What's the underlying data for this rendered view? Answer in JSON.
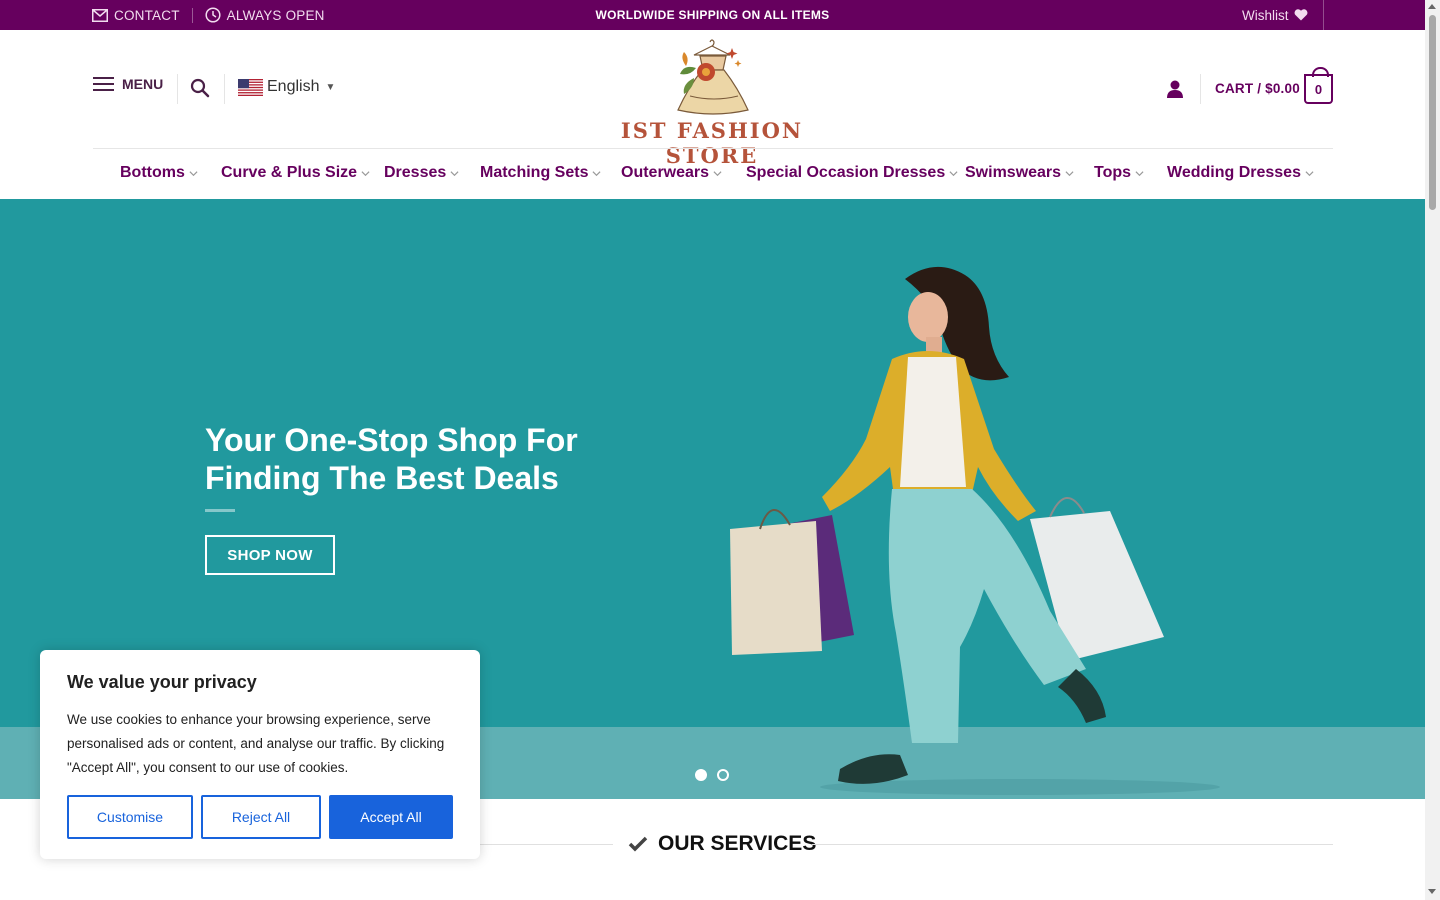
{
  "topbar": {
    "contact": "CONTACT",
    "always_open": "ALWAYS OPEN",
    "shipping": "WORLDWIDE SHIPPING ON ALL ITEMS",
    "wishlist": "Wishlist"
  },
  "header": {
    "menu_label": "MENU",
    "language": "English",
    "logo_text": "IST FASHION STORE",
    "cart_label": "CART / $0.00",
    "cart_count": "0"
  },
  "nav": {
    "items": [
      {
        "label": "Bottoms"
      },
      {
        "label": "Curve & Plus Size"
      },
      {
        "label": "Dresses"
      },
      {
        "label": "Matching Sets"
      },
      {
        "label": "Outerwears"
      },
      {
        "label": "Special Occasion Dresses"
      },
      {
        "label": "Swimswears"
      },
      {
        "label": "Tops"
      },
      {
        "label": "Wedding Dresses"
      }
    ]
  },
  "hero": {
    "title": "Your One-Stop Shop For Finding The Best Deals",
    "cta": "SHOP NOW",
    "slides": 2,
    "active_slide": 1
  },
  "services": {
    "title": "OUR SERVICES"
  },
  "cookie": {
    "title": "We value your privacy",
    "text": "We use cookies to enhance your browsing experience, serve personalised ads or content, and analyse our traffic. By clicking \"Accept All\", you consent to our use of cookies.",
    "customise": "Customise",
    "reject": "Reject All",
    "accept": "Accept All"
  },
  "colors": {
    "brand": "#66005e",
    "hero_bg": "#21999e",
    "cookie_button": "#1863dc"
  }
}
